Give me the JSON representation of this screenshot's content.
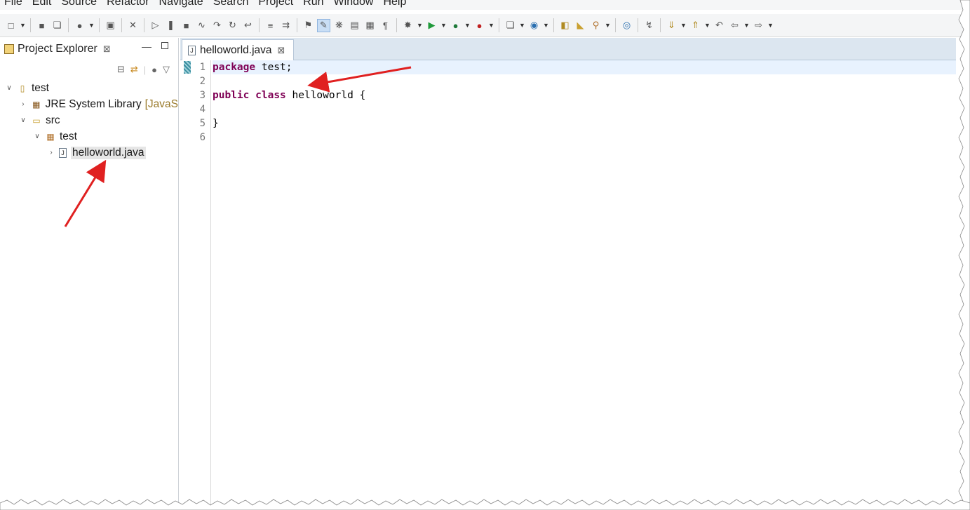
{
  "menu": [
    "File",
    "Edit",
    "Source",
    "Refactor",
    "Navigate",
    "Search",
    "Project",
    "Run",
    "Window",
    "Help"
  ],
  "explorer": {
    "title": "Project Explorer",
    "close": "⊠",
    "tree": {
      "project": "test",
      "jre": "JRE System Library",
      "jre_decoration": "[JavaS",
      "src": "src",
      "package": "test",
      "file": "helloworld.java"
    }
  },
  "editor": {
    "tab_label": "helloworld.java",
    "tab_close": "⊠",
    "line_numbers": [
      "1",
      "2",
      "3",
      "4",
      "5",
      "6"
    ],
    "code": {
      "line1_kw": "package",
      "line1_rest": " test;",
      "line3_kw1": "public",
      "line3_kw2": "class",
      "line3_rest": " helloworld {",
      "line5": "}"
    }
  },
  "colors": {
    "keyword": "#7f0055",
    "arrow": "#e02020",
    "tab_bar": "#dce6f0"
  }
}
